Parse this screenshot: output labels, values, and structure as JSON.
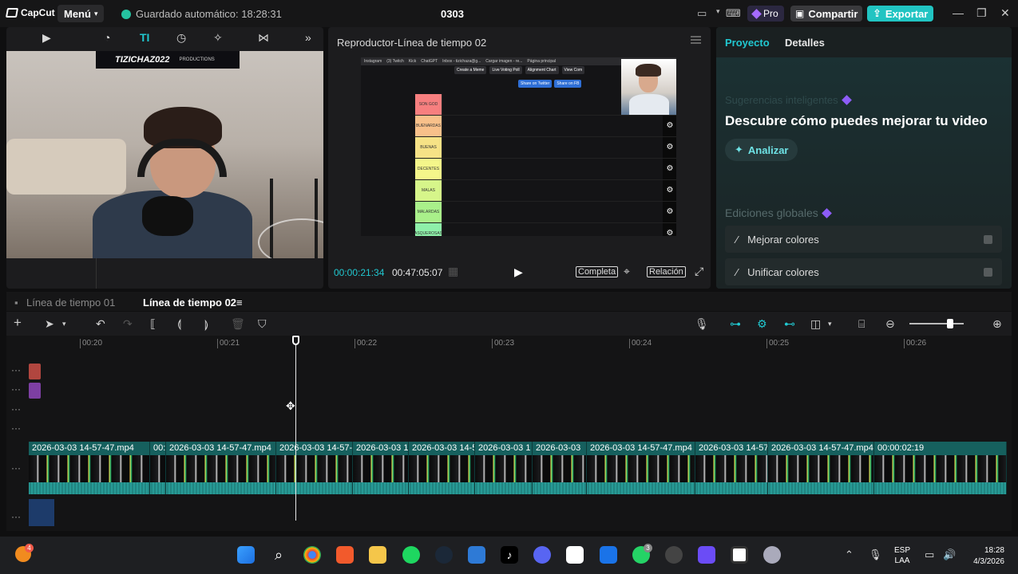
{
  "app": {
    "brand": "CapCut",
    "menu_label": "Menú",
    "autosave": "Guardado automático: 18:28:31",
    "project_name": "0303",
    "pro_label": "Pro",
    "share_label": "Compartir",
    "export_label": "Exportar"
  },
  "media": {
    "tabs": [
      "media",
      "audio",
      "text",
      "stickers",
      "effects",
      "transitions"
    ],
    "webcam_banner": "TIZICHAZ022",
    "webcam_banner_sub": "PRODUCTIONS"
  },
  "player": {
    "title": "Reproductor-Línea de tiempo 02",
    "current_time": "00:00:21:34",
    "total_time": "00:47:05:07",
    "full_label": "Completa",
    "ratio_label": "Relación",
    "preview": {
      "bookmarks": [
        "Instagram",
        "(3) Twitch",
        "Kick",
        "ChatGPT",
        "Inbox - tizichaza@g...",
        "Cargar imagen - re...",
        "Página principal"
      ],
      "buttons": [
        "Create a Meme",
        "Live Voting Poll",
        "Alignment Chart",
        "View Com"
      ],
      "share_buttons": [
        "Share on Twitter",
        "Share on FB"
      ],
      "tiers": [
        {
          "label": "SON GOD",
          "color": "#f77f7f"
        },
        {
          "label": "BUENARDAS",
          "color": "#f8c08a"
        },
        {
          "label": "BUENAS",
          "color": "#f6e286"
        },
        {
          "label": "DECENTES",
          "color": "#f4f68a"
        },
        {
          "label": "MALAS",
          "color": "#d6f58a"
        },
        {
          "label": "MALARDAS",
          "color": "#a9f08a"
        },
        {
          "label": "ASQUEROSAS",
          "color": "#8ef0a9"
        }
      ]
    }
  },
  "right_panel": {
    "tab_project": "Proyecto",
    "tab_details": "Detalles",
    "smart_suggestions": "Sugerencias inteligentes",
    "headline": "Descubre cómo puedes mejorar tu video",
    "analyze": "Analizar",
    "global_edits": "Ediciones globales",
    "improve_colors": "Mejorar colores",
    "unify_colors": "Unificar colores"
  },
  "timeline": {
    "tab1": "Línea de tiempo 01",
    "tab2": "Línea de tiempo 02",
    "ruler": [
      "|00:20",
      "|00:21",
      "|00:22",
      "|00:23",
      "|00:24",
      "|00:25",
      "|00:26"
    ],
    "clips": [
      "2026-03-03 14-57-47.mp4",
      "00:0",
      "2026-03-03 14-57-47.mp4",
      "2026-03-03 14-57-",
      "2026-03-03 1",
      "2026-03-03 14-5",
      "2026-03-03 1",
      "2026-03-03",
      "2026-03-03 14-57-47.mp4",
      "2026-03-03 14-57",
      "2026-03-03 14-57-47.mp4",
      "00:00:02:19"
    ]
  },
  "taskbar": {
    "weather_badge": "4",
    "whatsapp_badge": "3",
    "lang_top": "ESP",
    "lang_bottom": "LAA",
    "time": "18:28",
    "date": "4/3/2026"
  }
}
